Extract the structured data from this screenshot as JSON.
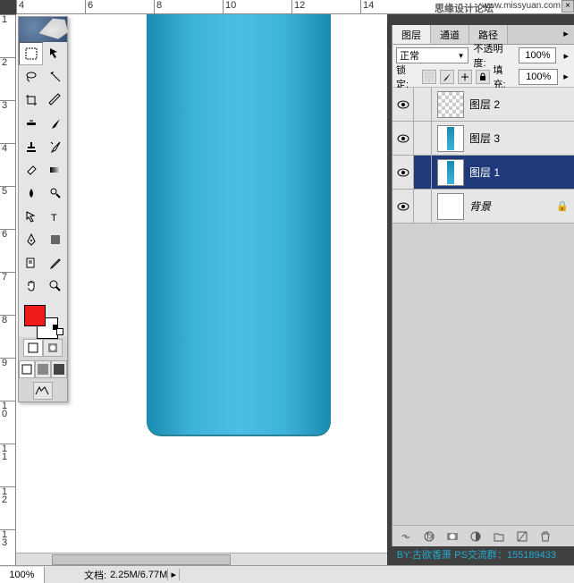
{
  "ruler_h": [
    "4",
    "6",
    "8",
    "10",
    "12",
    "14"
  ],
  "ruler_v": [
    "1",
    "2",
    "3",
    "4",
    "5",
    "6",
    "7",
    "8",
    "9",
    "1 0",
    "1 1",
    "1 2",
    "1 3"
  ],
  "watermark": {
    "title": "思缘设计论坛",
    "url": "www.missyuan.com"
  },
  "panel": {
    "tabs": {
      "layers": "图层",
      "channels": "通道",
      "paths": "路径"
    },
    "blend_mode": "正常",
    "opacity_label": "不透明度:",
    "opacity_value": "100%",
    "lock_label": "锁定:",
    "fill_label": "填充:",
    "fill_value": "100%"
  },
  "layers": [
    {
      "name": "图层 2",
      "thumb": "trans"
    },
    {
      "name": "图层 3",
      "thumb": "bar"
    },
    {
      "name": "图层 1",
      "thumb": "bar",
      "selected": true
    },
    {
      "name": "背景",
      "thumb": "white",
      "italic": true,
      "locked": true
    }
  ],
  "status": {
    "zoom": "100%",
    "doc_label": "文档:",
    "doc_value": "2.25M/6.77M"
  },
  "credit": {
    "by_label": "BY:",
    "author": "古欲香萧",
    "group_label": "PS交流群：",
    "group_num": "155189433"
  },
  "swatch_fg": "#ee1b1b"
}
